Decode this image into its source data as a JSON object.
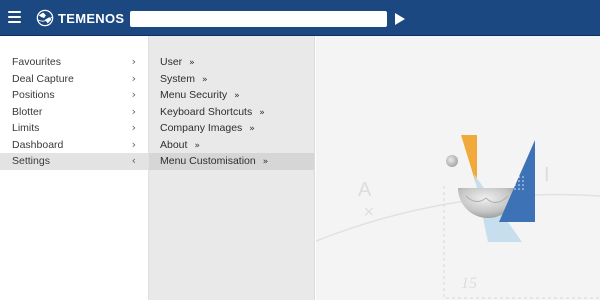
{
  "header": {
    "brand": "TEMENOS",
    "search": {
      "value": "",
      "placeholder": ""
    },
    "icons": {
      "menu": "hamburger-icon",
      "logo": "temenos-globe-logo",
      "go": "play-arrow-icon"
    },
    "colors": {
      "bar": "#1c4882"
    }
  },
  "left_menu": {
    "items": [
      {
        "label": "Favourites",
        "chevron": "›"
      },
      {
        "label": "Deal Capture",
        "chevron": "›"
      },
      {
        "label": "Positions",
        "chevron": "›"
      },
      {
        "label": "Blotter",
        "chevron": "›"
      },
      {
        "label": "Limits",
        "chevron": "›"
      },
      {
        "label": "Dashboard",
        "chevron": "›"
      },
      {
        "label": "Settings",
        "chevron": "‹",
        "active": true
      }
    ]
  },
  "sub_menu": {
    "items": [
      {
        "label": "User",
        "marker": "»"
      },
      {
        "label": "System",
        "marker": "»"
      },
      {
        "label": "Menu Security",
        "marker": "»"
      },
      {
        "label": "Keyboard Shortcuts",
        "marker": "»"
      },
      {
        "label": "Company Images",
        "marker": "»"
      },
      {
        "label": "About",
        "marker": "»"
      },
      {
        "label": "Menu Customisation",
        "marker": "»",
        "active": true
      }
    ]
  },
  "background": {
    "letter_a": "A",
    "letter_x": "×",
    "letter_i": "I",
    "number": "15"
  }
}
